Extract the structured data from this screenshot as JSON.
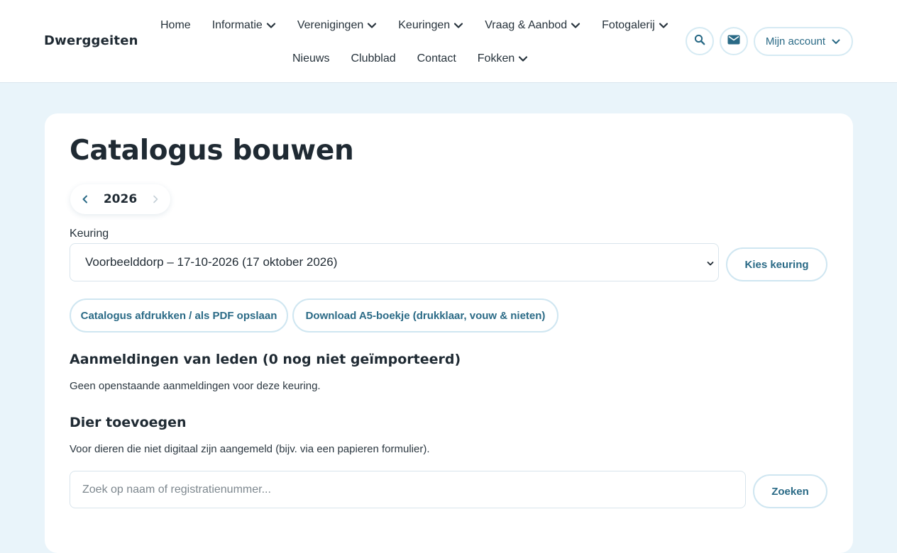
{
  "header": {
    "logo": "Dwerggeiten",
    "nav_row1": [
      {
        "label": "Home",
        "has_dropdown": false
      },
      {
        "label": "Informatie",
        "has_dropdown": true
      },
      {
        "label": "Verenigingen",
        "has_dropdown": true
      },
      {
        "label": "Keuringen",
        "has_dropdown": true
      },
      {
        "label": "Vraag & Aanbod",
        "has_dropdown": true
      },
      {
        "label": "Fotogalerij",
        "has_dropdown": true
      }
    ],
    "nav_row2": [
      {
        "label": "Nieuws",
        "has_dropdown": false
      },
      {
        "label": "Clubblad",
        "has_dropdown": false
      },
      {
        "label": "Contact",
        "has_dropdown": false
      },
      {
        "label": "Fokken",
        "has_dropdown": true
      }
    ],
    "search_icon": "search-icon",
    "mail_icon": "mail-icon",
    "account_label": "Mijn account"
  },
  "main": {
    "title": "Catalogus bouwen",
    "year": "2026",
    "keuring_label": "Keuring",
    "keuring_selected": "Voorbeelddorp – 17-10-2026 (17 oktober 2026)",
    "choose_button": "Kies keuring",
    "print_button": "Catalogus afdrukken / als PDF opslaan",
    "download_button": "Download A5-boekje (drukklaar, vouw & nieten)",
    "registrations_title": "Aanmeldingen van leden (0 nog niet geïmporteerd)",
    "registrations_text": "Geen openstaande aanmeldingen voor deze keuring.",
    "add_title": "Dier toevoegen",
    "add_text": "Voor dieren die niet digitaal zijn aangemeld (bijv. via een papieren formulier).",
    "search_placeholder": "Zoek op naam of registratienummer...",
    "search_button": "Zoeken"
  },
  "colors": {
    "background": "#e9f4fa",
    "accent": "#2a6a86",
    "button_border": "#cfe6f1"
  }
}
